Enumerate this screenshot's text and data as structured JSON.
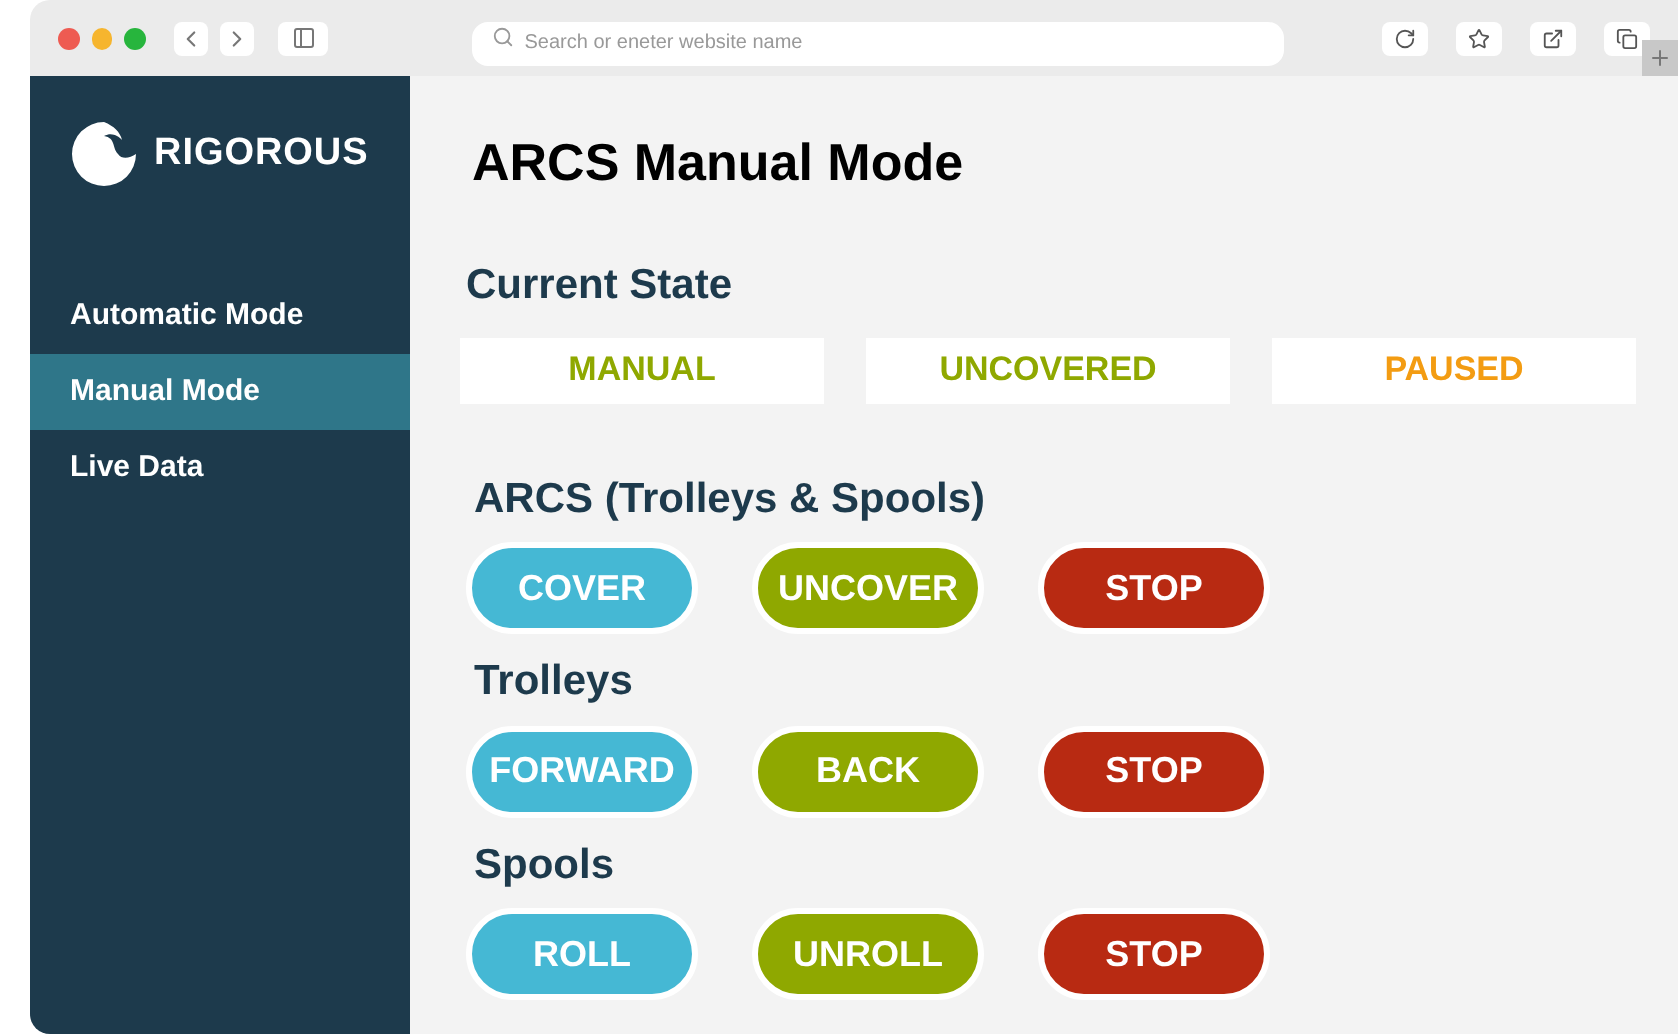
{
  "browser": {
    "search": {
      "placeholder": "Search or eneter website name"
    }
  },
  "sidebar": {
    "brand": "RIGOROUS",
    "items": [
      {
        "label": "Automatic Mode",
        "selected": false
      },
      {
        "label": "Manual Mode",
        "selected": true
      },
      {
        "label": "Live Data",
        "selected": false
      }
    ]
  },
  "page": {
    "title": "ARCS Manual Mode",
    "current_state": {
      "heading": "Current State",
      "states": [
        {
          "label": "MANUAL",
          "color": "#8fa800"
        },
        {
          "label": "UNCOVERED",
          "color": "#8fa800"
        },
        {
          "label": "PAUSED",
          "color": "#f39c12"
        }
      ]
    },
    "sections": [
      {
        "heading": "ARCS (Trolleys & Spools)",
        "buttons": [
          {
            "label": "COVER",
            "color": "#45b8d4"
          },
          {
            "label": "UNCOVER",
            "color": "#8fa800"
          },
          {
            "label": "STOP",
            "color": "#b82a12"
          }
        ]
      },
      {
        "heading": "Trolleys",
        "buttons": [
          {
            "label": "FORWARD",
            "color": "#45b8d4"
          },
          {
            "label": "BACK",
            "color": "#8fa800"
          },
          {
            "label": "STOP",
            "color": "#b82a12"
          }
        ]
      },
      {
        "heading": "Spools",
        "buttons": [
          {
            "label": "ROLL",
            "color": "#45b8d4"
          },
          {
            "label": "UNROLL",
            "color": "#8fa800"
          },
          {
            "label": "STOP",
            "color": "#b82a12"
          }
        ]
      }
    ]
  }
}
